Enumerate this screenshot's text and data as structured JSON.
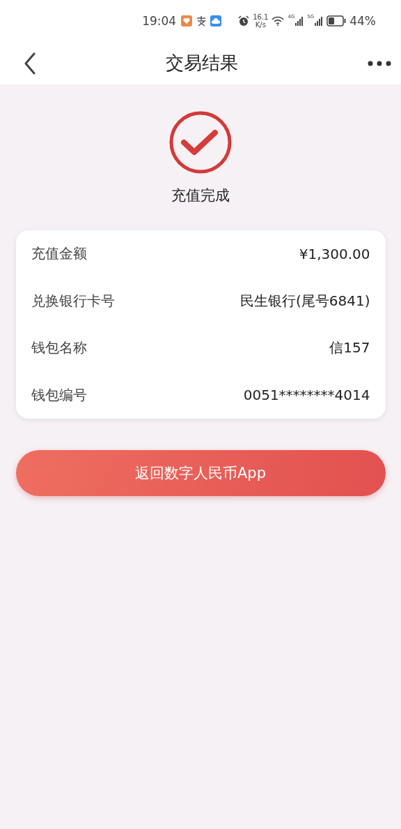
{
  "status_bar": {
    "time": "19:04",
    "speed_value": "16.1",
    "speed_unit": "K/s",
    "network_1": "4G",
    "network_2": "5G",
    "battery": "44%"
  },
  "header": {
    "title": "交易结果"
  },
  "result": {
    "status": "充值完成"
  },
  "details": [
    {
      "label": "充值金额",
      "value": "¥1,300.00"
    },
    {
      "label": "兑换银行卡号",
      "value": "民生银行(尾号6841)"
    },
    {
      "label": "钱包名称",
      "value": "信157"
    },
    {
      "label": "钱包编号",
      "value": "0051********4014"
    }
  ],
  "button": {
    "label": "返回数字人民币App"
  }
}
